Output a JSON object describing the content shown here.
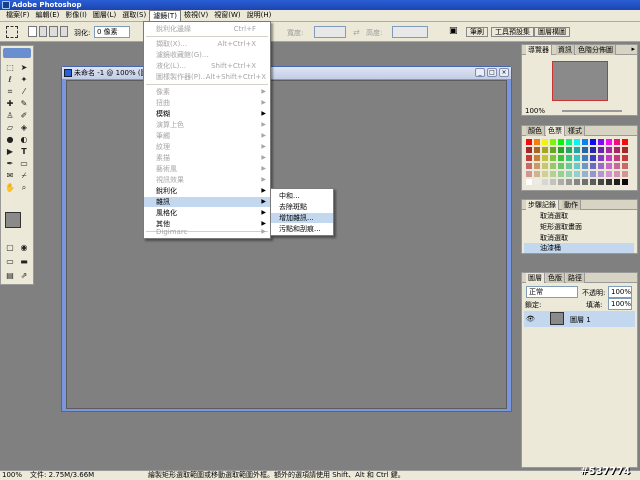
{
  "app": {
    "title": "Adobe Photoshop"
  },
  "menubar": [
    {
      "label": "檔案(F)"
    },
    {
      "label": "編輯(E)"
    },
    {
      "label": "影像(I)"
    },
    {
      "label": "圖層(L)"
    },
    {
      "label": "選取(S)"
    },
    {
      "label": "濾鏡(T)"
    },
    {
      "label": "檢視(V)"
    },
    {
      "label": "視窗(W)"
    },
    {
      "label": "說明(H)"
    }
  ],
  "options": {
    "feather_label": "羽化:",
    "feather_value": "0 像素",
    "width_label": "寬度:",
    "height_label": "高度:"
  },
  "palette_tabs": [
    "筆刷",
    "工具預設集",
    "圖層構圖"
  ],
  "document": {
    "title": "未命名 -1 @ 100% (圖層..."
  },
  "filter_menu": {
    "items": [
      {
        "label": "銳利化邊緣",
        "shortcut": "Ctrl+F",
        "disabled": true
      },
      {
        "label": "擷取(X)...",
        "shortcut": "Alt+Ctrl+X",
        "disabled": true
      },
      {
        "label": "濾鏡收藏館(G)...",
        "shortcut": "",
        "disabled": true
      },
      {
        "label": "液化(L)...",
        "shortcut": "Shift+Ctrl+X",
        "disabled": true
      },
      {
        "label": "圖樣製作器(P)...",
        "shortcut": "Alt+Shift+Ctrl+X",
        "disabled": true
      },
      {
        "label": "像素",
        "disabled": true
      },
      {
        "label": "扭曲",
        "disabled": true
      },
      {
        "label": "模糊",
        "disabled": false
      },
      {
        "label": "演算上色",
        "disabled": true
      },
      {
        "label": "筆觸",
        "disabled": true
      },
      {
        "label": "紋理",
        "disabled": true
      },
      {
        "label": "素描",
        "disabled": true
      },
      {
        "label": "藝術風",
        "disabled": true
      },
      {
        "label": "視訊效果",
        "disabled": true
      },
      {
        "label": "銳利化",
        "disabled": false
      },
      {
        "label": "雜訊",
        "disabled": false,
        "highlighted": true
      },
      {
        "label": "風格化",
        "disabled": false
      },
      {
        "label": "其他",
        "disabled": false
      },
      {
        "label": "Digimarc",
        "disabled": true
      }
    ]
  },
  "noise_submenu": {
    "items": [
      {
        "label": "中和..."
      },
      {
        "label": "去除斑點"
      },
      {
        "label": "增加雜訊...",
        "highlighted": true
      },
      {
        "label": "污點和刮痕..."
      }
    ]
  },
  "navigator": {
    "tabs": [
      "導覽器",
      "資訊",
      "色階分佈圖"
    ],
    "zoom": "100%"
  },
  "color": {
    "tabs": [
      "顏色",
      "色票",
      "樣式"
    ]
  },
  "history": {
    "tabs": [
      "步驟記錄",
      "動作"
    ],
    "items": [
      "取消選取",
      "矩形選取畫面",
      "取消選取",
      "油漆桶"
    ]
  },
  "layers": {
    "tabs": [
      "圖層",
      "色版",
      "路徑"
    ],
    "blend_mode": "正常",
    "opacity_label": "不透明:",
    "opacity_value": "100%",
    "lock_label": "鎖定:",
    "fill_label": "填滿:",
    "fill_value": "100%",
    "layer_name": "圖層 1"
  },
  "status": {
    "zoom": "100%",
    "doc_size": "文件: 2.75M/3.66M",
    "hint": "繪製矩形選取範圍或移動選取範圍外框。額外的選項請使用 Shift、Alt 和 Ctrl 鍵。"
  },
  "watermark": "#537774",
  "colors": {
    "title_blue": "#2a5fd6",
    "chrome": "#ece9d8",
    "highlight": "#c3d8ee",
    "canvas_gray": "#808080"
  }
}
